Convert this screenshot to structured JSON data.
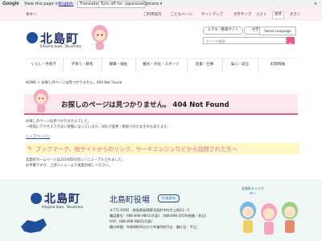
{
  "translate_bar": {
    "google": "Google",
    "view_in": "View this page in:",
    "language": "English",
    "translate": "Translate",
    "turn_off": "Turn off for: Japanese",
    "options": "Options ▾"
  },
  "util_bar": {
    "home": "本文へ",
    "links": [
      "ご利用案内",
      "こどもページ",
      "サイトマップ"
    ],
    "font_size_label": "文字サイズ",
    "font_sizes": [
      "小さく",
      "標準",
      "大きく"
    ]
  },
  "header": {
    "logo": "北島町",
    "logo_sub": "Kitajima town, Tokushima",
    "buttons": [
      "ミマホ・携帯サイト",
      "文字サイズ変更"
    ],
    "select_language": "Select Language",
    "search_placeholder": "サイト内検索"
  },
  "nav": [
    "くらし・手続き",
    "子育て・教育",
    "健康・福祉",
    "観光・文化・スポーツ",
    "産業・仕事",
    "安心・安全",
    "町政情報"
  ],
  "breadcrumb": "HOME > お探しのページは見つかりません。404 Not Found",
  "page": {
    "title": "お探しのページは見つかりません。 404 Not Found",
    "para1": "お探しのページは見つかりませんでした。",
    "para2": "一時的にアクセスできない状態になっているか、URLが変更・削除されたおそれもあります。",
    "top_link": "トップページへ",
    "sub_heading": "ブックマーク、他サイトからのリンク、サーチエンジンなどから訪問された方へ",
    "para3": "北島町ホームページは2016年03月にリニューアルされました。",
    "para4": "お手数ですが、上部メニューより再度お探しください。"
  },
  "footer": {
    "logo": "北島町",
    "logo_sub": "Kitajima town, Tokushima",
    "office": "北島町役場",
    "map_button": "庁舎案内",
    "lines": [
      "〒771-0295　徳島県板野郡北島町中村字上地23－1",
      "電話番号：088-698-9801(代表)　088-698-1919(夜間・休日)",
      "FAX：088-698-9842(代表)",
      "開庁時間：午前8時30分から午後5時15分　開庁日：平日"
    ],
    "mascot_caption": "北島町キャラクター"
  },
  "colors": {
    "accent": "#e85b8c",
    "brand": "#1f2f6b",
    "heading_bg": "#fde8ee",
    "footer_bg": "#eef7f4"
  }
}
